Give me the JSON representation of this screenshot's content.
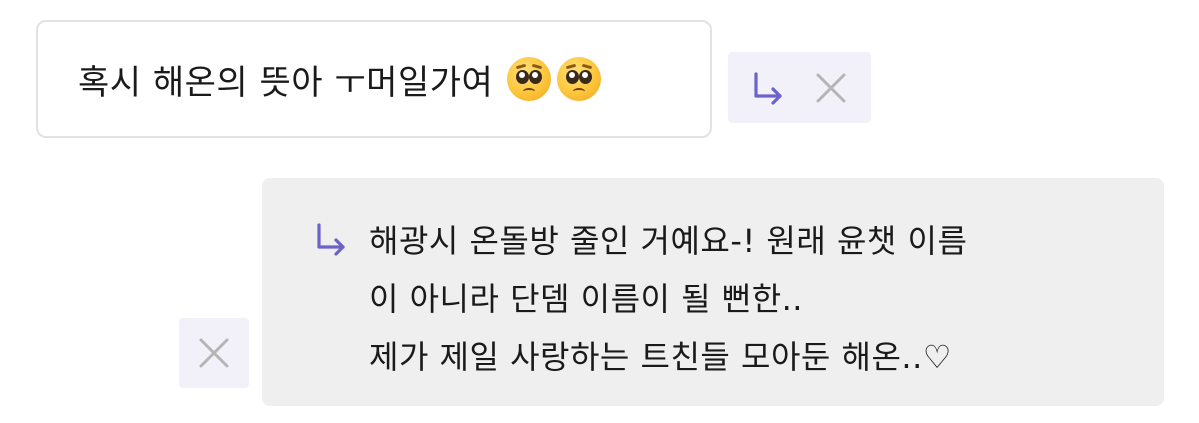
{
  "question": {
    "text": "혹시 해온의 뜻아 ㅜ머일가여",
    "emojis": [
      "pleading-face-emoji",
      "pleading-face-emoji"
    ]
  },
  "question_actions": {
    "reply_icon": "reply-arrow-icon",
    "close_icon": "close-icon"
  },
  "answer": {
    "lines": [
      "해광시 온돌방 줄인 거예요-! 원래 윤챗 이름",
      "이 아니라 단뎀 이름이 될 뻔한..",
      "제가 제일 사랑하는 트친들 모아둔 해온..♡"
    ],
    "reply_icon": "reply-arrow-icon",
    "close_icon": "close-icon"
  },
  "colors": {
    "accent": "#6b63c9",
    "action_bg": "#f2f1fa",
    "answer_bg": "#efefef",
    "card_border": "#e2e2e2",
    "close_icon": "#b5b5b5"
  }
}
